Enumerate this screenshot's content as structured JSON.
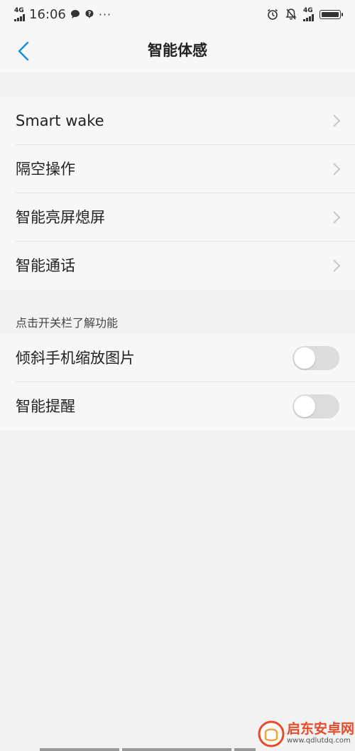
{
  "status_bar": {
    "network_label_left": "4G",
    "time": "16:06",
    "more": "···",
    "network_label_right": "4G"
  },
  "header": {
    "title": "智能体感"
  },
  "group1": {
    "items": [
      {
        "label": "Smart wake"
      },
      {
        "label": "隔空操作"
      },
      {
        "label": "智能亮屏熄屏"
      },
      {
        "label": "智能通话"
      }
    ]
  },
  "group2": {
    "section_label": "点击开关栏了解功能",
    "items": [
      {
        "label": "倾斜手机缩放图片",
        "enabled": false
      },
      {
        "label": "智能提醒",
        "enabled": false
      }
    ]
  },
  "watermark": {
    "text": "启东安卓网",
    "url": "www.qdlutdq.com"
  },
  "colors": {
    "accent": "#1a8fe3",
    "background": "#f2f2f2",
    "card": "#f7f7f7",
    "toggle_off": "#dcdcdc",
    "watermark": "#e64b2a"
  }
}
